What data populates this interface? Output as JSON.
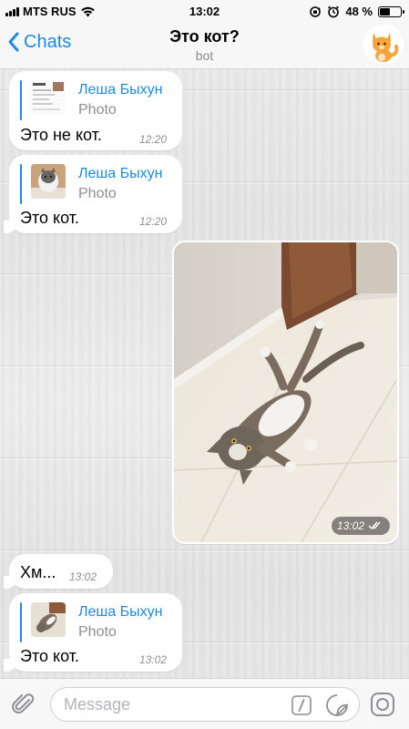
{
  "status_bar": {
    "carrier": "MTS RUS",
    "time": "13:02",
    "battery_percent": "48 %",
    "battery_level": 0.48
  },
  "nav": {
    "back_label": "Chats",
    "title": "Это кот?",
    "subtitle": "bot"
  },
  "messages": [
    {
      "reply_name": "Леша Быхун",
      "reply_kind": "Photo",
      "text": "Это не кот.",
      "time": "12:20"
    },
    {
      "reply_name": "Леша Быхун",
      "reply_kind": "Photo",
      "text": "Это кот.",
      "time": "12:20"
    },
    {
      "photo_time": "13:02"
    },
    {
      "text": "Хм...",
      "time": "13:02"
    },
    {
      "reply_name": "Леша Быхун",
      "reply_kind": "Photo",
      "text": "Это кот.",
      "time": "13:02"
    }
  ],
  "input": {
    "placeholder": "Message"
  },
  "colors": {
    "accent": "#1d89e4",
    "bubble": "#ffffff",
    "bar_bg": "#f7f7f7"
  }
}
